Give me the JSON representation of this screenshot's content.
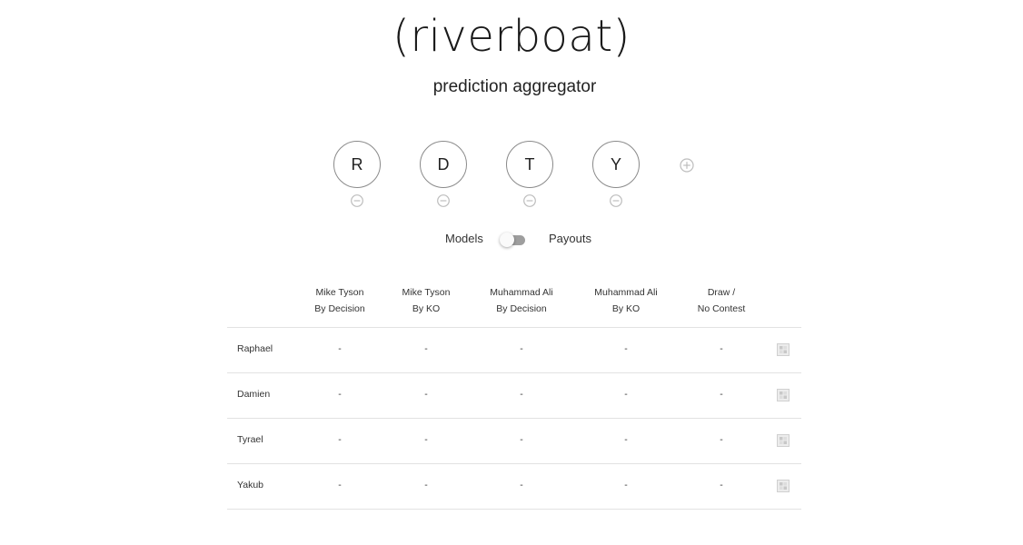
{
  "header": {
    "title": "(riverboat)",
    "subtitle": "prediction aggregator"
  },
  "models": [
    {
      "initial": "R"
    },
    {
      "initial": "D"
    },
    {
      "initial": "T"
    },
    {
      "initial": "Y"
    }
  ],
  "toggle": {
    "left_label": "Models",
    "right_label": "Payouts",
    "state": "off"
  },
  "table": {
    "columns": [
      {
        "line1": "Mike Tyson",
        "line2": "By Decision"
      },
      {
        "line1": "Mike Tyson",
        "line2": "By KO"
      },
      {
        "line1": "Muhammad Ali",
        "line2": "By Decision"
      },
      {
        "line1": "Muhammad Ali",
        "line2": "By KO"
      },
      {
        "line1": "Draw /",
        "line2": "No Contest"
      }
    ],
    "rows": [
      {
        "name": "Raphael",
        "values": [
          "-",
          "-",
          "-",
          "-",
          "-"
        ]
      },
      {
        "name": "Damien",
        "values": [
          "-",
          "-",
          "-",
          "-",
          "-"
        ]
      },
      {
        "name": "Tyrael",
        "values": [
          "-",
          "-",
          "-",
          "-",
          "-"
        ]
      },
      {
        "name": "Yakub",
        "values": [
          "-",
          "-",
          "-",
          "-",
          "-"
        ]
      }
    ]
  },
  "colors": {
    "icon_gray": "#bdbdbd",
    "divider": "#e2e2e2"
  }
}
